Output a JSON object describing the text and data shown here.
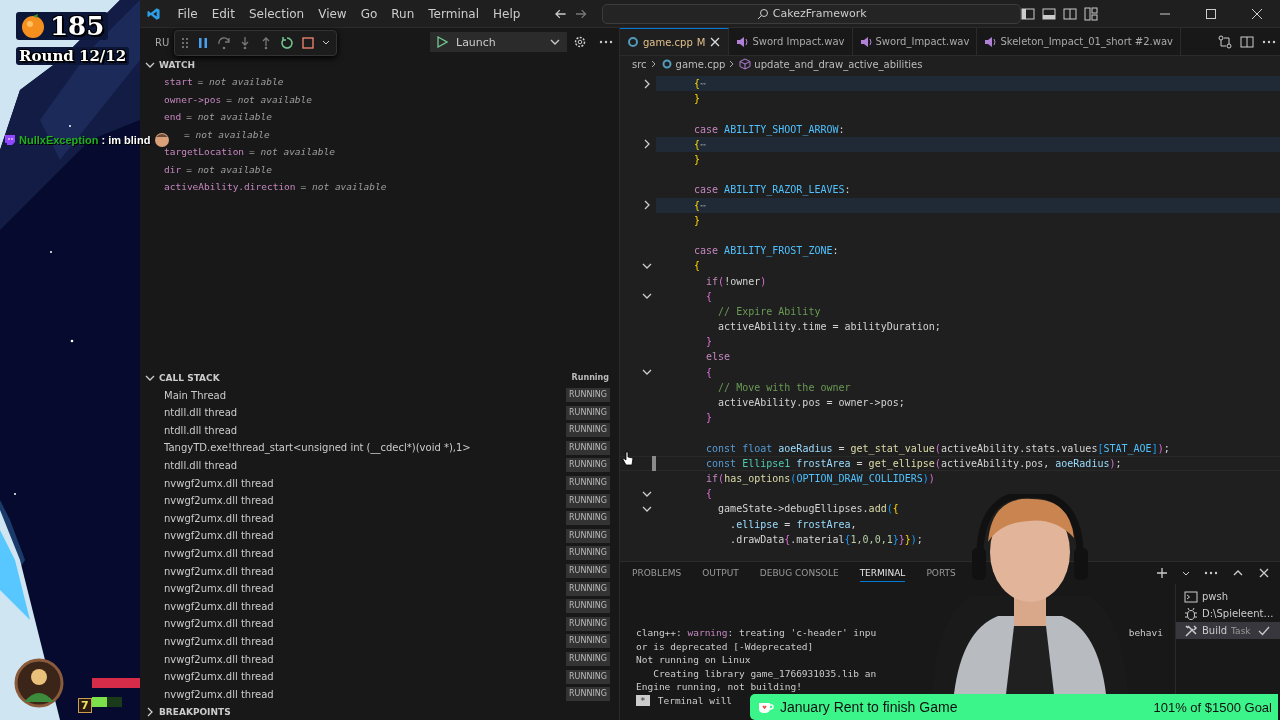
{
  "stream_overlay": {
    "score": "185",
    "round": "Round 12/12",
    "chat": {
      "user": "NullxException",
      "message": ": im blind"
    },
    "hud": {
      "level_badge": "7",
      "health": {
        "level": 1
      },
      "energy": {
        "level": 0.5
      }
    }
  },
  "title_bar": {
    "menu": [
      "File",
      "Edit",
      "Selection",
      "View",
      "Go",
      "Run",
      "Terminal",
      "Help"
    ],
    "search": "CakezFramework"
  },
  "debug": {
    "view_title": "RU",
    "launch_config": "Launch"
  },
  "watch": {
    "title": "WATCH",
    "expanded": true,
    "items": [
      {
        "name": "start",
        "value": "= *not available*"
      },
      {
        "name": "owner->pos",
        "value": "= *not available*"
      },
      {
        "name": "end",
        "value": "= *not available*"
      },
      {
        "value": "= *not available*"
      },
      {
        "name": "targetLocation",
        "value": "= *not available*"
      },
      {
        "name": "dir",
        "value": "= *not available*"
      },
      {
        "name": "activeAbility.direction",
        "value": "= *not available*"
      }
    ]
  },
  "call_stack": {
    "title": "CALL STACK",
    "state": "Running",
    "expanded": true,
    "threads": [
      {
        "name": "Main Thread",
        "status": "RUNNING"
      },
      {
        "name": "ntdll.dll thread",
        "status": "RUNNING"
      },
      {
        "name": "ntdll.dll thread",
        "status": "RUNNING"
      },
      {
        "name": "TangyTD.exe!thread_start<unsigned int (__cdecl*)(void *),1>",
        "status": "RUNNING"
      },
      {
        "name": "ntdll.dll thread",
        "status": "RUNNING"
      },
      {
        "name": "nvwgf2umx.dll thread",
        "status": "RUNNING"
      },
      {
        "name": "nvwgf2umx.dll thread",
        "status": "RUNNING"
      },
      {
        "name": "nvwgf2umx.dll thread",
        "status": "RUNNING"
      },
      {
        "name": "nvwgf2umx.dll thread",
        "status": "RUNNING"
      },
      {
        "name": "nvwgf2umx.dll thread",
        "status": "RUNNING"
      },
      {
        "name": "nvwgf2umx.dll thread",
        "status": "RUNNING"
      },
      {
        "name": "nvwgf2umx.dll thread",
        "status": "RUNNING"
      },
      {
        "name": "nvwgf2umx.dll thread",
        "status": "RUNNING"
      },
      {
        "name": "nvwgf2umx.dll thread",
        "status": "RUNNING"
      },
      {
        "name": "nvwgf2umx.dll thread",
        "status": "RUNNING"
      },
      {
        "name": "nvwgf2umx.dll thread",
        "status": "RUNNING"
      },
      {
        "name": "nvwgf2umx.dll thread",
        "status": "RUNNING"
      },
      {
        "name": "nvwgf2umx.dll thread",
        "status": "RUNNING"
      }
    ]
  },
  "breakpoints": {
    "title": "BREAKPOINTS",
    "expanded": false
  },
  "editor": {
    "tabs": [
      {
        "label": "game.cpp",
        "kind": "cpp",
        "badge": "M",
        "selected": true
      },
      {
        "label": "Sword Impact.wav",
        "kind": "wav",
        "selected": false
      },
      {
        "label": "Sword_Impact.wav",
        "kind": "wav",
        "selected": false
      },
      {
        "label": "Skeleton_Impact_01_short #2.wav",
        "kind": "wav",
        "selected": false
      }
    ],
    "breadcrumbs": [
      {
        "kind": "folder",
        "label": "src"
      },
      {
        "kind": "file",
        "label": "game.cpp"
      },
      {
        "kind": "symbol",
        "label": "update_and_draw_active_abilities"
      }
    ],
    "lines": [
      {
        "kind": "code",
        "collapsed": true,
        "current": false,
        "tokens": [
          {
            "kind": "brace1",
            "text": "{"
          },
          {
            "kind": "ellipsis",
            "text": "⋯"
          }
        ]
      },
      {
        "kind": "code",
        "current": false,
        "tokens": [
          {
            "kind": "brace1",
            "text": "}"
          }
        ]
      },
      {
        "kind": "blank",
        "current": false
      },
      {
        "kind": "code",
        "current": false,
        "tokens": [
          {
            "kind": "keyword",
            "text": "case "
          },
          {
            "kind": "enum",
            "text": "ABILITY_SHOOT_ARROW"
          },
          {
            "kind": "plain",
            "text": ":"
          }
        ]
      },
      {
        "kind": "code",
        "collapsed": true,
        "current": false,
        "tokens": [
          {
            "kind": "brace1",
            "text": "{"
          },
          {
            "kind": "ellipsis",
            "text": "⋯"
          }
        ]
      },
      {
        "kind": "code",
        "current": false,
        "tokens": [
          {
            "kind": "brace1",
            "text": "}"
          }
        ]
      },
      {
        "kind": "blank",
        "current": false
      },
      {
        "kind": "code",
        "current": false,
        "tokens": [
          {
            "kind": "keyword",
            "text": "case "
          },
          {
            "kind": "enum",
            "text": "ABILITY_RAZOR_LEAVES"
          },
          {
            "kind": "plain",
            "text": ":"
          }
        ]
      },
      {
        "kind": "code",
        "collapsed": true,
        "current": false,
        "tokens": [
          {
            "kind": "brace1",
            "text": "{"
          },
          {
            "kind": "ellipsis",
            "text": "⋯"
          }
        ]
      },
      {
        "kind": "code",
        "current": false,
        "tokens": [
          {
            "kind": "brace1",
            "text": "}"
          }
        ]
      },
      {
        "kind": "blank",
        "current": false
      },
      {
        "kind": "code",
        "current": false,
        "tokens": [
          {
            "kind": "keyword",
            "text": "case "
          },
          {
            "kind": "enum",
            "text": "ABILITY_FROST_ZONE"
          },
          {
            "kind": "plain",
            "text": ":"
          }
        ]
      },
      {
        "kind": "code",
        "collapsed": false,
        "current": false,
        "tokens": [
          {
            "kind": "brace1",
            "text": "{"
          }
        ]
      },
      {
        "kind": "code",
        "current": false,
        "tokens": [
          {
            "kind": "keyword",
            "text": "  if"
          },
          {
            "kind": "brace2",
            "text": "("
          },
          {
            "kind": "plain",
            "text": "!owner"
          },
          {
            "kind": "brace2",
            "text": ")"
          }
        ]
      },
      {
        "kind": "code",
        "collapsed": false,
        "current": false,
        "tokens": [
          {
            "kind": "brace2",
            "text": "  {"
          }
        ]
      },
      {
        "kind": "code",
        "current": false,
        "tokens": [
          {
            "kind": "comment",
            "text": "    // Expire Ability"
          }
        ]
      },
      {
        "kind": "code",
        "current": false,
        "tokens": [
          {
            "kind": "plain",
            "text": "    activeAbility.time = abilityDuration;"
          }
        ]
      },
      {
        "kind": "code",
        "current": false,
        "tokens": [
          {
            "kind": "brace2",
            "text": "  }"
          }
        ]
      },
      {
        "kind": "code",
        "current": false,
        "tokens": [
          {
            "kind": "keyword",
            "text": "  else"
          }
        ]
      },
      {
        "kind": "code",
        "collapsed": false,
        "current": false,
        "tokens": [
          {
            "kind": "brace2",
            "text": "  {"
          }
        ]
      },
      {
        "kind": "code",
        "current": false,
        "tokens": [
          {
            "kind": "comment",
            "text": "    // Move with the owner"
          }
        ]
      },
      {
        "kind": "code",
        "current": false,
        "tokens": [
          {
            "kind": "plain",
            "text": "    activeAbility.pos = owner->pos;"
          }
        ]
      },
      {
        "kind": "code",
        "current": false,
        "tokens": [
          {
            "kind": "brace2",
            "text": "  }"
          }
        ]
      },
      {
        "kind": "blank",
        "current": false
      },
      {
        "kind": "code",
        "current": false,
        "tokens": [
          {
            "kind": "storage",
            "text": "  const float "
          },
          {
            "kind": "variable",
            "text": "aoeRadius"
          },
          {
            "kind": "plain",
            "text": " = "
          },
          {
            "kind": "function",
            "text": "get_stat_value"
          },
          {
            "kind": "brace2",
            "text": "("
          },
          {
            "kind": "plain",
            "text": "activeAbility.stats.values"
          },
          {
            "kind": "brace3",
            "text": "["
          },
          {
            "kind": "enum",
            "text": "STAT_AOE"
          },
          {
            "kind": "brace3",
            "text": "]"
          },
          {
            "kind": "brace2",
            "text": ")"
          },
          {
            "kind": "plain",
            "text": ";"
          }
        ]
      },
      {
        "kind": "code",
        "current": true,
        "tokens": [
          {
            "kind": "storage",
            "text": "  const "
          },
          {
            "kind": "type",
            "text": "Ellipse1 "
          },
          {
            "kind": "variable",
            "text": "frostArea"
          },
          {
            "kind": "plain",
            "text": " = "
          },
          {
            "kind": "function",
            "text": "get_ellipse"
          },
          {
            "kind": "brace2",
            "text": "("
          },
          {
            "kind": "plain",
            "text": "activeAbility.pos, "
          },
          {
            "kind": "variable",
            "text": "aoeRadius"
          },
          {
            "kind": "brace2",
            "text": ")"
          },
          {
            "kind": "plain",
            "text": ";"
          }
        ]
      },
      {
        "kind": "code",
        "current": false,
        "tokens": [
          {
            "kind": "keyword",
            "text": "  if"
          },
          {
            "kind": "brace2",
            "text": "("
          },
          {
            "kind": "function",
            "text": "has_options"
          },
          {
            "kind": "brace3",
            "text": "("
          },
          {
            "kind": "enum",
            "text": "OPTION_DRAW_COLLIDERS"
          },
          {
            "kind": "brace3",
            "text": ")"
          },
          {
            "kind": "brace2",
            "text": ")"
          }
        ]
      },
      {
        "kind": "code",
        "collapsed": false,
        "current": false,
        "tokens": [
          {
            "kind": "brace2",
            "text": "  {"
          }
        ]
      },
      {
        "kind": "code",
        "collapsed": false,
        "current": false,
        "tokens": [
          {
            "kind": "plain",
            "text": "    gameState->debugEllipses."
          },
          {
            "kind": "function",
            "text": "add"
          },
          {
            "kind": "brace3",
            "text": "("
          },
          {
            "kind": "brace1",
            "text": "{"
          }
        ]
      },
      {
        "kind": "code",
        "current": false,
        "tokens": [
          {
            "kind": "plain",
            "text": "      ."
          },
          {
            "kind": "variable",
            "text": "ellipse"
          },
          {
            "kind": "plain",
            "text": " = "
          },
          {
            "kind": "variable",
            "text": "frostArea"
          },
          {
            "kind": "plain",
            "text": ","
          }
        ]
      },
      {
        "kind": "code",
        "current": false,
        "tokens": [
          {
            "kind": "plain",
            "text": "      .drawData"
          },
          {
            "kind": "brace2",
            "text": "{"
          },
          {
            "kind": "plain",
            "text": ".material"
          },
          {
            "kind": "brace3",
            "text": "{"
          },
          {
            "kind": "number",
            "text": "1,0,0,1"
          },
          {
            "kind": "brace3",
            "text": "}"
          },
          {
            "kind": "brace2",
            "text": "}"
          },
          {
            "kind": "brace1",
            "text": "}"
          },
          {
            "kind": "brace3",
            "text": ")"
          },
          {
            "kind": "plain",
            "text": ";"
          }
        ]
      }
    ]
  },
  "panel": {
    "tabs": [
      {
        "label": "PROBLEMS",
        "selected": false
      },
      {
        "label": "OUTPUT",
        "selected": false
      },
      {
        "label": "DEBUG CONSOLE",
        "selected": false
      },
      {
        "label": "TERMINAL",
        "selected": true
      },
      {
        "label": "PORTS",
        "selected": false
      }
    ],
    "terminal_lines": [
      {
        "kind": "text",
        "segments": [
          {
            "kind": "plain",
            "text": "clang++: "
          },
          {
            "kind": "warning",
            "text": "warning"
          },
          {
            "kind": "plain",
            "text": ": treating 'c-header' inpu"
          }
        ],
        "tail": "behavi"
      },
      {
        "kind": "text",
        "segments": [
          {
            "kind": "plain",
            "text": "or is deprecated [-Wdeprecated]"
          }
        ]
      },
      {
        "kind": "text",
        "segments": [
          {
            "kind": "plain",
            "text": "Not running on Linux"
          }
        ]
      },
      {
        "kind": "text",
        "segments": [
          {
            "kind": "plain",
            "text": "   Creating library game_1766931035.lib an"
          }
        ]
      },
      {
        "kind": "text",
        "segments": [
          {
            "kind": "plain",
            "text": "Engine running, not building!"
          }
        ]
      },
      {
        "kind": "prompt",
        "marker": "*",
        "segments": [
          {
            "kind": "plain",
            "text": "Terminal will"
          }
        ]
      }
    ],
    "terminals": [
      {
        "kind": "shell",
        "label": "pwsh",
        "selected": false
      },
      {
        "kind": "debug",
        "label": "D:\\Spieleent…",
        "selected": false
      },
      {
        "kind": "task",
        "label": "Build",
        "detail": "Task",
        "selected": true
      }
    ]
  },
  "goal": {
    "title": "January Rent to finish Game",
    "progress": "101% of $1500 Goal",
    "level": 1
  }
}
